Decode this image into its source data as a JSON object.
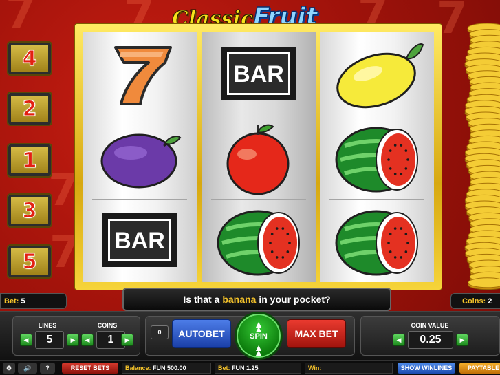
{
  "game": {
    "logo_word1": "Classic",
    "logo_word2": "Fruit"
  },
  "paylines": [
    {
      "label": "4"
    },
    {
      "label": "2"
    },
    {
      "label": "1"
    },
    {
      "label": "3"
    },
    {
      "label": "5"
    }
  ],
  "reels": [
    {
      "symbols": [
        "seven",
        "plum",
        "bar"
      ]
    },
    {
      "symbols": [
        "bar",
        "tomato",
        "watermelon"
      ]
    },
    {
      "symbols": [
        "lemon",
        "watermelon",
        "watermelon"
      ]
    }
  ],
  "symbol_text": {
    "bar": "BAR"
  },
  "message": {
    "before": "Is that a",
    "highlight": "banana",
    "after": "in your pocket?"
  },
  "bet_info": {
    "label": "Bet:",
    "value": "5"
  },
  "coins_info": {
    "label": "Coins:",
    "value": "2"
  },
  "controls": {
    "lines_label": "LINES",
    "lines_value": "5",
    "coins_label": "COINS",
    "coins_value": "1",
    "autospin_count": "0",
    "autobet_label": "AUTOBET",
    "spin_label": "SPIN",
    "maxbet_label": "MAX BET",
    "coin_value_label": "COIN VALUE",
    "coin_value": "0.25"
  },
  "status_bar": {
    "settings_icon": "gear-icon",
    "sound_icon": "speaker-icon",
    "help_label": "?",
    "reset_bets_label": "RESET BETS",
    "balance_label": "Balance:",
    "balance_value": "FUN 500.00",
    "bet_label": "Bet:",
    "bet_value": "FUN 1.25",
    "win_label": "Win:",
    "win_value": "",
    "show_winlines_label": "SHOW WINLINES",
    "paytable_label": "PAYTABLE"
  },
  "colors": {
    "accent_gold": "#f5c32a",
    "spin_green": "#1d9a1d",
    "autobet_blue": "#2a55c8",
    "maxbet_red": "#c8231a"
  }
}
